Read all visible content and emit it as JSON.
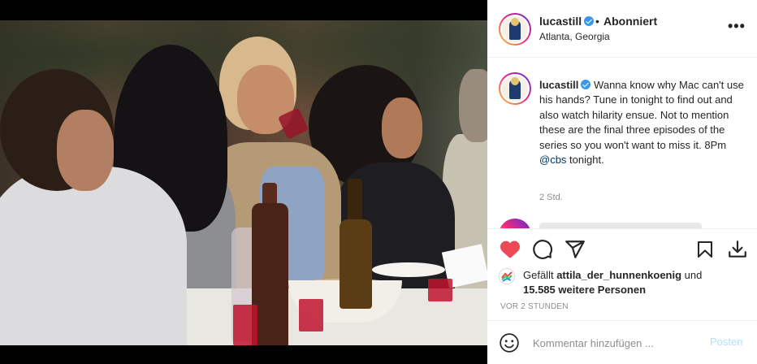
{
  "colors": {
    "accent": "#0095f6",
    "like_red": "#ed4956",
    "muted": "#8e8e8e",
    "post_button_disabled": "#b2dffc"
  },
  "header": {
    "username": "lucastill",
    "dot": "•",
    "follow_status": "Abonniert",
    "location": "Atlanta, Georgia",
    "more_icon": "more-horizontal-icon",
    "more_label": "•••"
  },
  "caption": {
    "username": "lucastill",
    "text": "Wanna know why Mac can't use his hands? Tune in tonight to find out and also watch hilarity ensue. Not to mention these are the final three episodes of the series so you won't want to miss it. 8Pm ",
    "mention": "@cbs",
    "text_end": " tonight.",
    "time": "2 Std."
  },
  "actions": {
    "like_icon": "heart-filled-icon",
    "comment_icon": "comment-icon",
    "share_icon": "paper-plane-icon",
    "save_icon": "bookmark-icon",
    "download_icon": "download-icon",
    "liked": true
  },
  "likes": {
    "prefix": "Gefällt ",
    "user": "attila_der_hunnenkoenig",
    "joiner": " und",
    "others": "15.585 weitere Personen"
  },
  "post_age": "VOR 2 STUNDEN",
  "comment_box": {
    "emoji_icon": "emoji-smiley-icon",
    "placeholder": "Kommentar hinzufügen ...",
    "post_label": "Posten"
  }
}
